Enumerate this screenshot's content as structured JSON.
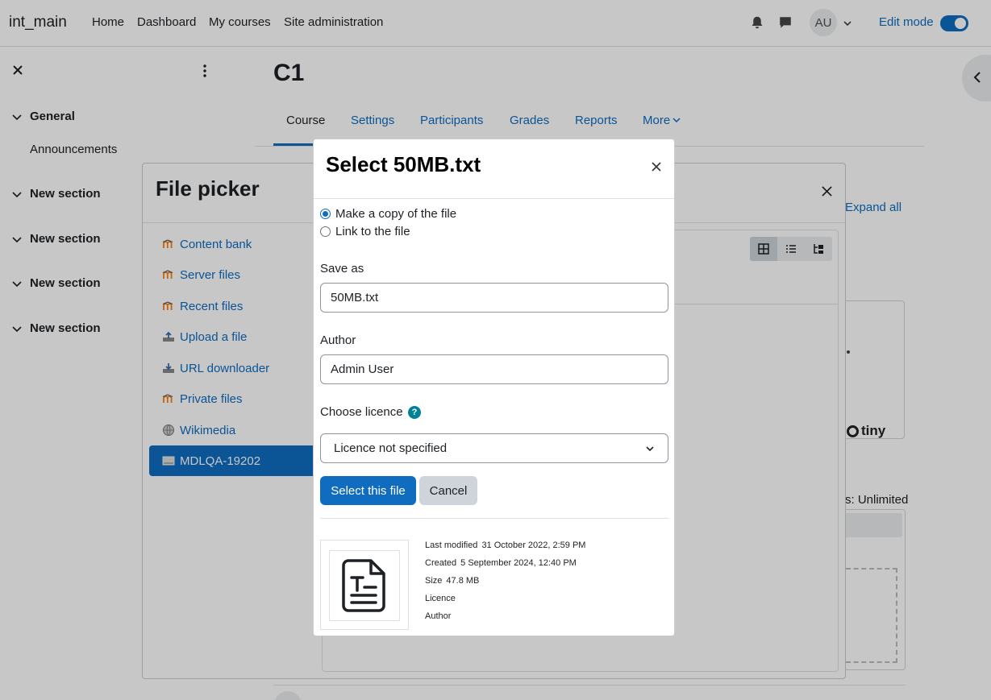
{
  "topnav": {
    "brand": "int_main",
    "links": [
      "Home",
      "Dashboard",
      "My courses",
      "Site administration"
    ],
    "avatar_initials": "AU",
    "edit_mode_label": "Edit mode"
  },
  "course_index": {
    "sections": [
      "General",
      "New section",
      "New section",
      "New section",
      "New section"
    ],
    "general_items": [
      "Announcements"
    ]
  },
  "course": {
    "title": "C1",
    "tabs": [
      "Course",
      "Settings",
      "Participants",
      "Grades",
      "Reports",
      "More"
    ],
    "expand_all": "Expand all",
    "unlimited_text": "s: Unlimited",
    "editor_brand": "tiny"
  },
  "file_picker": {
    "title": "File picker",
    "repositories": [
      {
        "label": "Content bank",
        "icon": "moodle-icon"
      },
      {
        "label": "Server files",
        "icon": "moodle-icon"
      },
      {
        "label": "Recent files",
        "icon": "moodle-icon"
      },
      {
        "label": "Upload a file",
        "icon": "upload-icon"
      },
      {
        "label": "URL downloader",
        "icon": "download-icon"
      },
      {
        "label": "Private files",
        "icon": "moodle-icon"
      },
      {
        "label": "Wikimedia",
        "icon": "globe-icon"
      },
      {
        "label": "MDLQA-19202",
        "icon": "drive-icon"
      }
    ],
    "active_repository": "MDLQA-19202"
  },
  "select_dialog": {
    "title": "Select 50MB.txt",
    "options": [
      "Make a copy of the file",
      "Link to the file"
    ],
    "selected_option": "Make a copy of the file",
    "save_as_label": "Save as",
    "save_as_value": "50MB.txt",
    "author_label": "Author",
    "author_value": "Admin User",
    "licence_label": "Choose licence",
    "licence_value": "Licence not specified",
    "select_button": "Select this file",
    "cancel_button": "Cancel",
    "meta": {
      "last_modified_label": "Last modified",
      "last_modified_value": "31 October 2022, 2:59 PM",
      "created_label": "Created",
      "created_value": "5 September 2024, 12:40 PM",
      "size_label": "Size",
      "size_value": "47.8 MB",
      "licence_label": "Licence",
      "author_label": "Author"
    }
  },
  "colors": {
    "primary": "#0f6cbf",
    "secondary_button": "#ced4da",
    "help": "#008196"
  }
}
